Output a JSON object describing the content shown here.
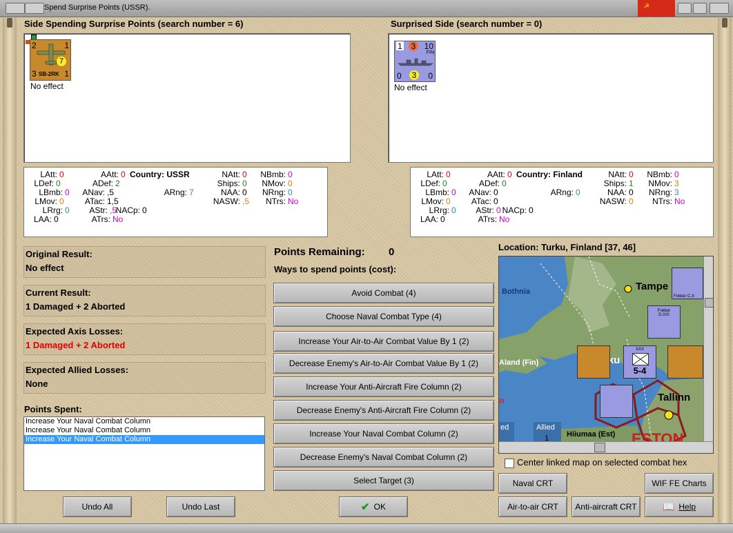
{
  "window": {
    "title": "Spend Surprise Points (USSR)."
  },
  "attacker": {
    "header": "Side Spending Surprise Points (search number = 6)",
    "unit": {
      "tl": "2",
      "tr": "1",
      "bl": "3",
      "br": "1",
      "badge": "7",
      "name": "SB-2RK",
      "color": "#c8892d"
    },
    "effect": "No effect"
  },
  "defender": {
    "header": "Surprised Side (search number = 0)",
    "unit": {
      "tl": "1",
      "tm": "3",
      "tr": "10",
      "nation": "FIN",
      "bl": "0",
      "bm": "3",
      "br": "0",
      "color": "#9a9ae0"
    },
    "effect": "No effect"
  },
  "stats_left": {
    "country": "Country: USSR",
    "items": [
      {
        "label": "LAtt:",
        "value": "0",
        "cls": "v0"
      },
      {
        "label": "AAtt:",
        "value": "0",
        "cls": "v0"
      },
      {
        "label": "NAtt:",
        "value": "0",
        "cls": "v0"
      },
      {
        "label": "NBmb:",
        "value": "0",
        "cls": "vm"
      },
      {
        "label": "LDef:",
        "value": "0",
        "cls": "vg"
      },
      {
        "label": "ADef:",
        "value": "2",
        "cls": "vg"
      },
      {
        "label": "Ships:",
        "value": "0",
        "cls": "vg"
      },
      {
        "label": "NMov:",
        "value": "0",
        "cls": "vo"
      },
      {
        "label": "LBmb:",
        "value": "0",
        "cls": "vm"
      },
      {
        "label": "ANav:",
        "value": ",5",
        "cls": "vk"
      },
      {
        "label": "ARng:",
        "value": "7",
        "cls": "vc"
      },
      {
        "label": "NAA:",
        "value": "0",
        "cls": "vk"
      },
      {
        "label": "NRng:",
        "value": "0",
        "cls": "vc"
      },
      {
        "label": "LMov:",
        "value": "0",
        "cls": "vo"
      },
      {
        "label": "ATac:",
        "value": "1,5",
        "cls": "vk"
      },
      {
        "label": "NASW:",
        "value": ",5",
        "cls": "vo"
      },
      {
        "label": "NTrs:",
        "value": "No",
        "cls": "vm"
      },
      {
        "label": "LRrg:",
        "value": "0",
        "cls": "vc"
      },
      {
        "label": "AStr:",
        "value": ",5",
        "cls": "vm"
      },
      {
        "label": "NACp:",
        "value": "0",
        "cls": "vk"
      },
      {
        "label": "LAA:",
        "value": "0",
        "cls": "vk"
      },
      {
        "label": "ATrs:",
        "value": "No",
        "cls": "vm"
      }
    ]
  },
  "stats_right": {
    "country": "Country: Finland",
    "items": [
      {
        "label": "LAtt:",
        "value": "0",
        "cls": "v0"
      },
      {
        "label": "AAtt:",
        "value": "0",
        "cls": "v0"
      },
      {
        "label": "NAtt:",
        "value": "0",
        "cls": "v0"
      },
      {
        "label": "NBmb:",
        "value": "0",
        "cls": "vm"
      },
      {
        "label": "LDef:",
        "value": "0",
        "cls": "vg"
      },
      {
        "label": "ADef:",
        "value": "0",
        "cls": "vg"
      },
      {
        "label": "Ships:",
        "value": "1",
        "cls": "vg"
      },
      {
        "label": "NMov:",
        "value": "3",
        "cls": "vo"
      },
      {
        "label": "LBmb:",
        "value": "0",
        "cls": "vm"
      },
      {
        "label": "ANav:",
        "value": "0",
        "cls": "vk"
      },
      {
        "label": "ARng:",
        "value": "0",
        "cls": "vc"
      },
      {
        "label": "NAA:",
        "value": "0",
        "cls": "vk"
      },
      {
        "label": "NRng:",
        "value": "3",
        "cls": "vc"
      },
      {
        "label": "LMov:",
        "value": "0",
        "cls": "vo"
      },
      {
        "label": "ATac:",
        "value": "0",
        "cls": "vk"
      },
      {
        "label": "NASW:",
        "value": "0",
        "cls": "vo"
      },
      {
        "label": "NTrs:",
        "value": "No",
        "cls": "vm"
      },
      {
        "label": "LRrg:",
        "value": "0",
        "cls": "vc"
      },
      {
        "label": "AStr:",
        "value": "0",
        "cls": "vm"
      },
      {
        "label": "NACp:",
        "value": "0",
        "cls": "vk"
      },
      {
        "label": "LAA:",
        "value": "0",
        "cls": "vk"
      },
      {
        "label": "ATrs:",
        "value": "No",
        "cls": "vm"
      }
    ]
  },
  "results": {
    "original_label": "Original Result:",
    "original_value": "No effect",
    "current_label": "Current Result:",
    "current_value": "1 Damaged + 2 Aborted",
    "axis_label": "Expected Axis Losses:",
    "axis_value": "1 Damaged + 2 Aborted",
    "allied_label": "Expected Allied Losses:",
    "allied_value": "None"
  },
  "points_spent": {
    "label": "Points Spent:",
    "items": [
      "Increase Your Naval Combat Column",
      "Increase Your Naval Combat Column",
      "Increase Your Naval Combat Column"
    ],
    "selected_index": 2
  },
  "points": {
    "remaining_label": "Points Remaining:",
    "remaining_value": "0",
    "ways_label": "Ways to spend points (cost):",
    "options": [
      "Avoid Combat (4)",
      "Choose Naval Combat Type (4)",
      "Increase Your Air-to-Air Combat Value By 1 (2)",
      "Decrease Enemy's Air-to-Air Combat Value By 1 (2)",
      "Increase Your Anti-Aircraft Fire Column (2)",
      "Decrease Enemy's Anti-Aircraft Fire Column (2)",
      "Increase Your Naval Combat Column (2)",
      "Decrease Enemy's Naval Combat Column (2)",
      "Select Target (3)"
    ]
  },
  "map": {
    "location": "Location: Turku, Finland [37, 46]",
    "labels": {
      "bothnia": "Bothnia",
      "tampere": "Tampe",
      "aland": "Aland (Fin)",
      "turku": "rku",
      "tallinn": "Tallinn",
      "hiiumaa": "Hiiumaa (Est)",
      "allied": "Allied",
      "allied_num": "1",
      "ed": "ed",
      "eston": "ESTON",
      "red_n": "n"
    },
    "stack_strength": "5-4",
    "stack_xxx": "XXX",
    "fokker1": "Fokker C.X",
    "fokker2": "Fokker D.XXI",
    "center_linked": "Center linked map on selected combat hex"
  },
  "buttons": {
    "undo_all": "Undo All",
    "undo_last": "Undo Last",
    "ok": "OK",
    "naval_crt": "Naval CRT",
    "wif_charts": "WIF FE Charts",
    "air_crt": "Air-to-air CRT",
    "aa_crt": "Anti-aircraft CRT",
    "help": "Help"
  }
}
